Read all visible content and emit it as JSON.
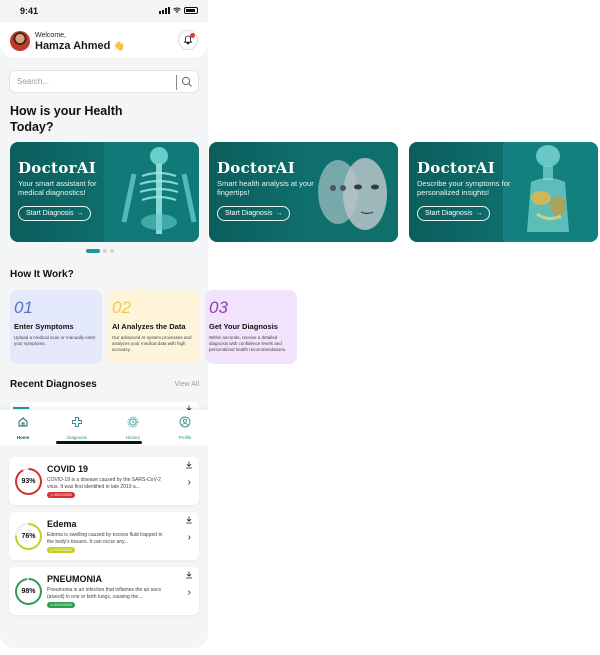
{
  "status": {
    "time": "9:41"
  },
  "header": {
    "welcome": "Welcome,",
    "user_name": "Hamza Ahmed",
    "wave": "👋"
  },
  "search": {
    "placeholder": "Search..."
  },
  "hero": {
    "title": "How is your Health Today?"
  },
  "banners": [
    {
      "brand": "DoctorAI",
      "subtitle": "Your smart assistant for medical diagnostics!",
      "button": "Start Diagnosis",
      "art": "skeleton"
    },
    {
      "brand": "DoctorAI",
      "subtitle": "Smart health analysis at your fingertips!",
      "button": "Start Diagnosis",
      "art": "faces"
    },
    {
      "brand": "DoctorAI",
      "subtitle": "Describe your symptoms for personalized insights!",
      "button": "Start Diagnosis",
      "art": "organs"
    }
  ],
  "how_it_works": {
    "title": "How It Work?",
    "steps": [
      {
        "num": "01",
        "title": "Enter Symptoms",
        "desc": "Upload a medical scan or manually enter your symptoms.",
        "bg": "#e4e8fb",
        "num_color": "#5b6fc4"
      },
      {
        "num": "02",
        "title": "AI Analyzes the Data",
        "desc": "Our advanced AI system processes and analyzes your medical data with high accuracy.",
        "bg": "#fdf4d9",
        "num_color": "#f2c94c"
      },
      {
        "num": "03",
        "title": "Get Your Diagnosis",
        "desc": "Within seconds, receive a detailed diagnosis with confidence levels and personalized health recommendations.",
        "bg": "#f1e3fb",
        "num_color": "#8e44ad"
      }
    ]
  },
  "recent": {
    "title": "Recent Diagnoses",
    "view_all": "View All"
  },
  "tabs": [
    {
      "label": "Home",
      "icon": "home-icon"
    },
    {
      "label": "Diagnosis",
      "icon": "plus-icon"
    },
    {
      "label": "History",
      "icon": "history-icon"
    },
    {
      "label": "Profile",
      "icon": "profile-icon"
    }
  ],
  "diagnoses": [
    {
      "name": "COVID 19",
      "percent": "93%",
      "value": 93,
      "desc": "COVID-19 is a disease caused by the SARS-CoV-2 virus. It was first identified in late 2019 a...",
      "date": "09/12/2025",
      "color": "#d32f2f"
    },
    {
      "name": "Edema",
      "percent": "76%",
      "value": 76,
      "desc": "Edema is swelling caused by excess fluid trapped in the body's tissues. It can occur any...",
      "date": "14/12/2024",
      "color": "#c6cf1f"
    },
    {
      "name": "PNEUMONIA",
      "percent": "98%",
      "value": 98,
      "desc": "Pneumonia is an infection that inflames the air sacs (alveoli) in one or both lungs, causing the...",
      "date": "02/12/2025",
      "color": "#2e9e4f"
    }
  ],
  "colors": {
    "accent": "#1a9a97",
    "banner": "#0f6f6d"
  }
}
